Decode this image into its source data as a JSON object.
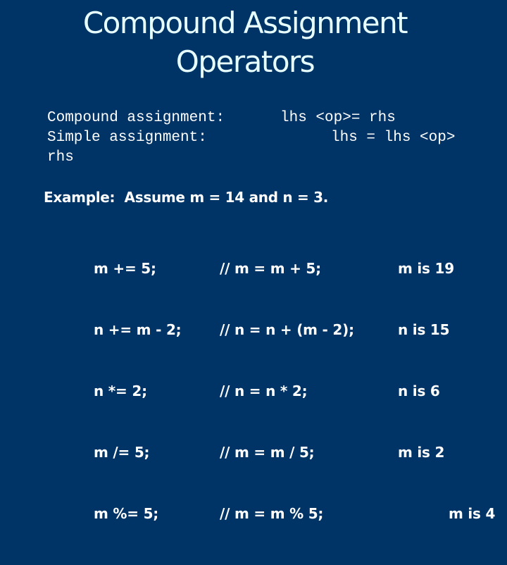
{
  "slide": {
    "title_lines": [
      "Compound Assignment",
      "Operators"
    ],
    "definitions": [
      {
        "label": "Compound assignment:",
        "form": "lhs <op>= rhs"
      },
      {
        "label": "Simple assignment:",
        "form": "lhs = lhs <op>",
        "continuation": "rhs"
      }
    ],
    "example_intro": "Example:  Assume m = 14 and n = 3.",
    "examples": [
      {
        "statement": "m += 5;",
        "comment": "// m = m + 5;",
        "result": "m is 19"
      },
      {
        "statement": "n += m - 2;",
        "comment": "// n = n + (m - 2);",
        "result": "n is 15"
      },
      {
        "statement": "n *= 2;",
        "comment": "// n = n * 2;",
        "result": "n is 6"
      },
      {
        "statement": "m /= 5;",
        "comment": "// m = m / 5;",
        "result": "m is 2"
      },
      {
        "statement": "m %= 5;",
        "comment": "// m = m % 5;",
        "result": "m is 4"
      }
    ],
    "colors": {
      "background": "#003466",
      "title": "#e8ffff",
      "text": "#ffffff"
    }
  }
}
